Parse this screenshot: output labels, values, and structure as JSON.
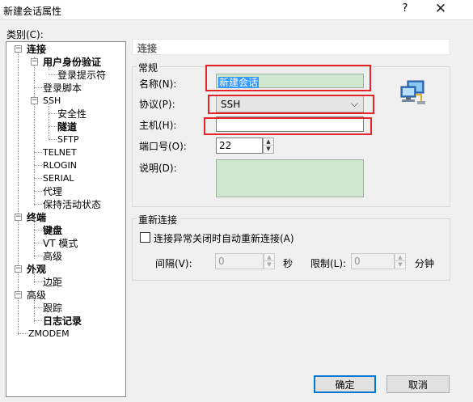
{
  "window": {
    "title": "新建会话属性",
    "help": "?",
    "close": "✕"
  },
  "category_label": "类别(C):",
  "tree": {
    "n_connect": "连接",
    "n_user_auth": "用户身份验证",
    "n_login_prompt": "登录提示符",
    "n_login_script": "登录脚本",
    "n_ssh": "SSH",
    "n_security": "安全性",
    "n_tunnel": "隧道",
    "n_sftp": "SFTP",
    "n_telnet": "TELNET",
    "n_rlogin": "RLOGIN",
    "n_serial": "SERIAL",
    "n_proxy": "代理",
    "n_keepalive": "保持活动状态",
    "n_terminal": "终端",
    "n_keyboard": "键盘",
    "n_vt_mode": "VT 模式",
    "n_advanced1": "高级",
    "n_appearance": "外观",
    "n_margin": "边距",
    "n_advanced2": "高级",
    "n_trace": "跟踪",
    "n_log": "日志记录",
    "n_zmodem": "ZMODEM"
  },
  "panel": {
    "header": "连接",
    "general": {
      "title": "常规",
      "name_label": "名称(N):",
      "name_value": "新建会话",
      "protocol_label": "协议(P):",
      "protocol_value": "SSH",
      "host_label": "主机(H):",
      "host_value": "",
      "port_label": "端口号(O):",
      "port_value": "22",
      "desc_label": "说明(D):",
      "desc_value": ""
    },
    "reconnect": {
      "title": "重新连接",
      "checkbox_label": "连接异常关闭时自动重新连接(A)",
      "interval_label": "间隔(V):",
      "interval_value": "0",
      "interval_unit": "秒",
      "limit_label": "限制(L):",
      "limit_value": "0",
      "limit_unit": "分钟"
    }
  },
  "buttons": {
    "ok": "确定",
    "cancel": "取消"
  },
  "colors": {
    "highlight": "#e8232a",
    "field_green": "#cde8cf",
    "selection": "#3399ff"
  }
}
